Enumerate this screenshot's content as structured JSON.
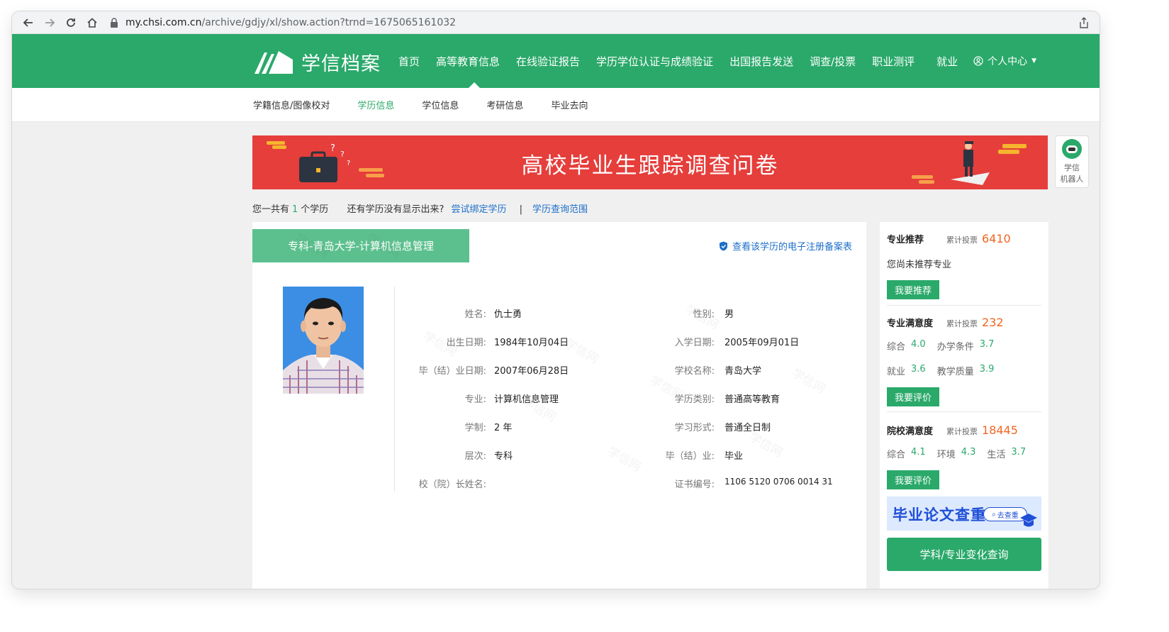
{
  "browser": {
    "url_host": "my.chsi.com.cn",
    "url_path": "/archive/gdjy/xl/show.action?trnd=1675065161032"
  },
  "header": {
    "logo_text": "学信档案",
    "menu": [
      "首页",
      "高等教育信息",
      "在线验证报告",
      "学历学位认证与成绩验证",
      "出国报告发送",
      "调查/投票",
      "职业测评",
      "就业"
    ],
    "user_menu": "个人中心"
  },
  "subnav": {
    "items": [
      "学籍信息/图像校对",
      "学历信息",
      "学位信息",
      "考研信息",
      "毕业去向"
    ],
    "active": "学历信息"
  },
  "banner": {
    "title": "高校毕业生跟踪调查问卷"
  },
  "robot": {
    "line1": "学信",
    "line2": "机器人"
  },
  "summary": {
    "prefix": "您一共有",
    "count": "1",
    "suffix": "个学历",
    "question": "还有学历没有显示出来?",
    "bind_link": "尝试绑定学历",
    "separator": "|",
    "scope_link": "学历查询范围"
  },
  "record": {
    "tab_title": "专科-青岛大学-计算机信息管理",
    "ereg_link": "查看该学历的电子注册备案表",
    "fields_left": [
      {
        "label": "姓名:",
        "value": "仇士勇"
      },
      {
        "label": "出生日期:",
        "value": "1984年10月04日"
      },
      {
        "label": "毕（结）业日期:",
        "value": "2007年06月28日"
      },
      {
        "label": "专业:",
        "value": "计算机信息管理"
      },
      {
        "label": "学制:",
        "value": "2 年"
      },
      {
        "label": "层次:",
        "value": "专科"
      },
      {
        "label": "校（院）长姓名:",
        "value": ""
      }
    ],
    "fields_right": [
      {
        "label": "性别:",
        "value": "男"
      },
      {
        "label": "入学日期:",
        "value": "2005年09月01日"
      },
      {
        "label": "学校名称:",
        "value": "青岛大学"
      },
      {
        "label": "学历类别:",
        "value": "普通高等教育"
      },
      {
        "label": "学习形式:",
        "value": "普通全日制"
      },
      {
        "label": "毕（结）业:",
        "value": "毕业"
      },
      {
        "label": "证书编号:",
        "value": "1106 5120 0706 0014 31"
      }
    ],
    "watermark": "学信网"
  },
  "side": {
    "major_rec": {
      "title": "专业推荐",
      "vote_label": "累计投票",
      "votes": "6410",
      "text": "您尚未推荐专业",
      "button": "我要推荐"
    },
    "major_sat": {
      "title": "专业满意度",
      "vote_label": "累计投票",
      "votes": "232",
      "row1": [
        {
          "k": "综合",
          "v": "4.0"
        },
        {
          "k": "办学条件",
          "v": "3.7"
        }
      ],
      "row2": [
        {
          "k": "就业",
          "v": "3.6"
        },
        {
          "k": "教学质量",
          "v": "3.9"
        }
      ],
      "button": "我要评价"
    },
    "school_sat": {
      "title": "院校满意度",
      "vote_label": "累计投票",
      "votes": "18445",
      "row1": [
        {
          "k": "综合",
          "v": "4.1"
        },
        {
          "k": "环境",
          "v": "4.3"
        },
        {
          "k": "生活",
          "v": "3.7"
        }
      ],
      "button": "我要评价"
    },
    "paper_banner": {
      "title": "毕业论文查重",
      "button": "去查重"
    },
    "big_button": "学科/专业变化查询"
  },
  "colors": {
    "brand_green": "#2aa96a",
    "banner_red": "#e53e3b",
    "link_blue": "#1e6fc9",
    "vote_orange": "#f26522"
  }
}
